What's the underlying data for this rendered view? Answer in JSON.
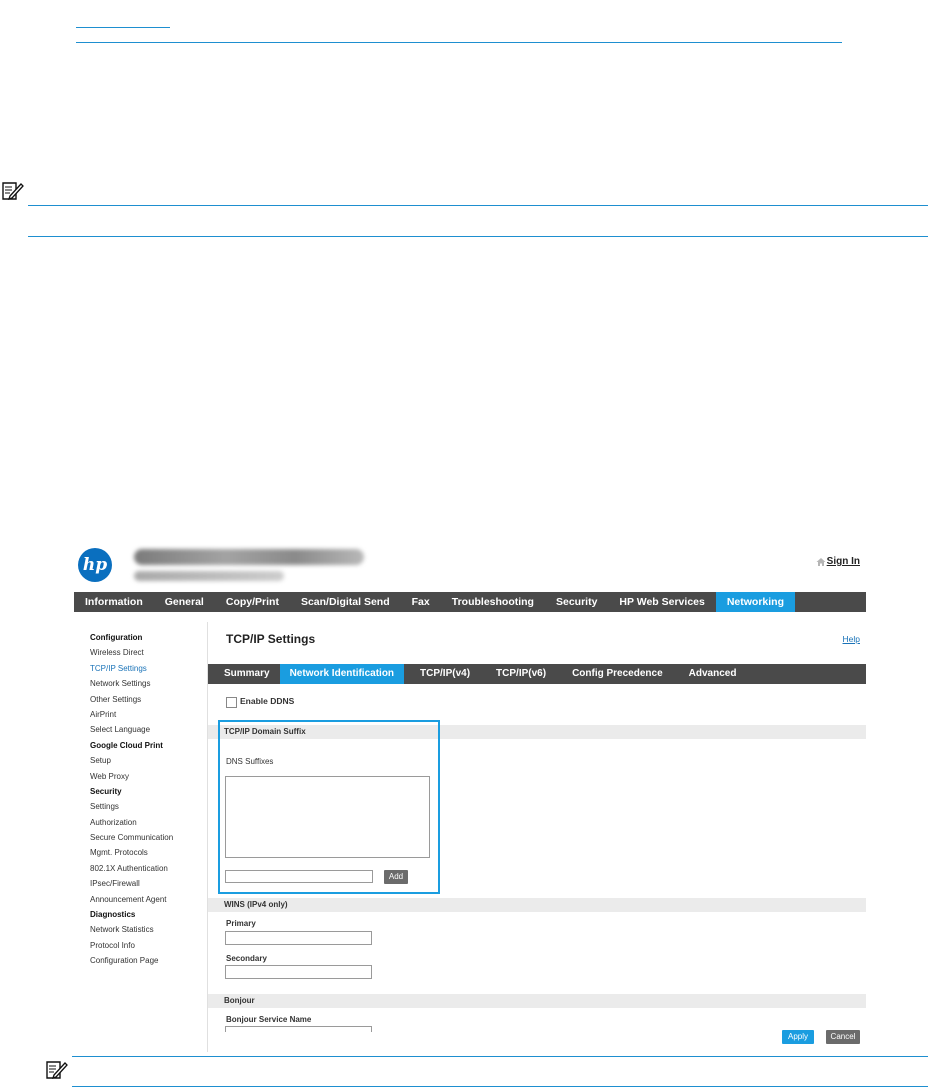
{
  "printer": {
    "logo_text": "hp",
    "sign_in_label": "Sign In"
  },
  "top_nav": [
    {
      "label": "Information",
      "active": false
    },
    {
      "label": "General",
      "active": false
    },
    {
      "label": "Copy/Print",
      "active": false
    },
    {
      "label": "Scan/Digital Send",
      "active": false
    },
    {
      "label": "Fax",
      "active": false
    },
    {
      "label": "Troubleshooting",
      "active": false
    },
    {
      "label": "Security",
      "active": false
    },
    {
      "label": "HP Web Services",
      "active": false
    },
    {
      "label": "Networking",
      "active": true
    }
  ],
  "sidebar": [
    {
      "label": "Configuration",
      "type": "head"
    },
    {
      "label": "Wireless Direct",
      "type": "link"
    },
    {
      "label": "TCP/IP Settings",
      "type": "active"
    },
    {
      "label": "Network Settings",
      "type": "link"
    },
    {
      "label": "Other Settings",
      "type": "link"
    },
    {
      "label": "AirPrint",
      "type": "link"
    },
    {
      "label": "Select Language",
      "type": "link"
    },
    {
      "label": "Google Cloud Print",
      "type": "head"
    },
    {
      "label": "Setup",
      "type": "link"
    },
    {
      "label": "Web Proxy",
      "type": "link"
    },
    {
      "label": "Security",
      "type": "head"
    },
    {
      "label": "Settings",
      "type": "link"
    },
    {
      "label": "Authorization",
      "type": "link"
    },
    {
      "label": "Secure Communication",
      "type": "link"
    },
    {
      "label": "Mgmt. Protocols",
      "type": "link"
    },
    {
      "label": "802.1X Authentication",
      "type": "link"
    },
    {
      "label": "IPsec/Firewall",
      "type": "link"
    },
    {
      "label": "Announcement Agent",
      "type": "link"
    },
    {
      "label": "Diagnostics",
      "type": "head"
    },
    {
      "label": "Network Statistics",
      "type": "link"
    },
    {
      "label": "Protocol Info",
      "type": "link"
    },
    {
      "label": "Configuration Page",
      "type": "link"
    }
  ],
  "main": {
    "title": "TCP/IP Settings",
    "help_label": "Help",
    "sub_tabs": [
      {
        "label": "Summary",
        "active": false
      },
      {
        "label": "Network Identification",
        "active": true
      },
      {
        "label": "TCP/IP(v4)",
        "active": false
      },
      {
        "label": "TCP/IP(v6)",
        "active": false
      },
      {
        "label": "Config Precedence",
        "active": false
      },
      {
        "label": "Advanced",
        "active": false
      }
    ],
    "enable_ddns_label": "Enable DDNS",
    "domain_suffix_heading": "TCP/IP Domain Suffix",
    "dns_suffixes_label": "DNS Suffixes",
    "add_label": "Add",
    "wins_heading": "WINS (IPv4 only)",
    "primary_label": "Primary",
    "secondary_label": "Secondary",
    "bonjour_heading": "Bonjour",
    "bonjour_service_name_label": "Bonjour Service Name",
    "apply_label": "Apply",
    "cancel_label": "Cancel"
  },
  "colors": {
    "accent": "#1a9de0",
    "nav_bg": "#4a4a4a",
    "rule": "#1e8fd0"
  }
}
